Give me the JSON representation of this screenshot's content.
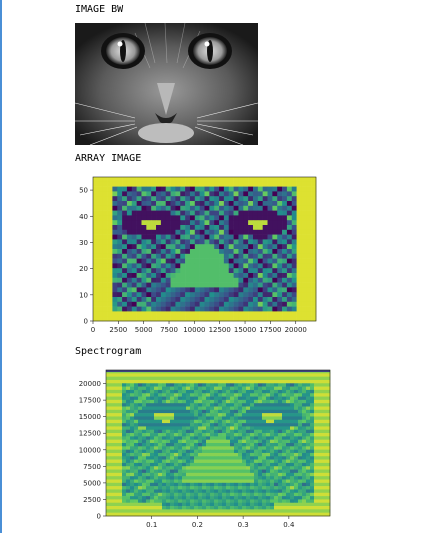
{
  "labels": {
    "image_bw": "IMAGE BW",
    "array_image": "ARRAY IMAGE",
    "spectrogram": "Spectrogram"
  },
  "colors": {
    "cell_border": "#4a8fd6",
    "viridis_dark": "#440154",
    "viridis_teal": "#21918c",
    "viridis_green": "#5ec962",
    "viridis_yellow": "#fde725"
  },
  "chart_data": [
    {
      "type": "heatmap",
      "title": "",
      "xlabel": "",
      "ylabel": "",
      "xlim": [
        0,
        22000
      ],
      "ylim": [
        0,
        55
      ],
      "x_ticks": [
        "0",
        "2500",
        "5000",
        "7500",
        "10000",
        "12500",
        "15000",
        "17500",
        "20000"
      ],
      "y_ticks": [
        "0",
        "10",
        "20",
        "30",
        "40",
        "50"
      ],
      "grid": false,
      "colormap": "viridis"
    },
    {
      "type": "heatmap",
      "title": "",
      "xlabel": "",
      "ylabel": "",
      "xlim": [
        0,
        0.49
      ],
      "ylim": [
        0,
        22050
      ],
      "x_ticks": [
        "0.1",
        "0.2",
        "0.3",
        "0.4"
      ],
      "y_ticks": [
        "0",
        "2500",
        "5000",
        "7500",
        "10000",
        "12500",
        "15000",
        "17500",
        "20000"
      ],
      "grid": false,
      "colormap": "viridis"
    }
  ]
}
